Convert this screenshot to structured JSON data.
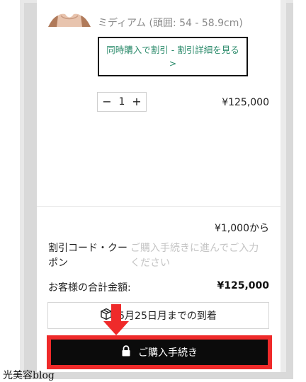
{
  "cart": {
    "item": {
      "variant": "ミディアム (頭囲: 54 - 58.9cm)",
      "promo_link": "同時購入で割引 - 割引詳細を見る >",
      "quantity": "1",
      "minus_label": "−",
      "plus_label": "+",
      "price": "¥125,000"
    },
    "summary": {
      "shipping": "¥1,000から",
      "discount_label": "割引コード・クーポン",
      "discount_placeholder": "ご購入手続きに進んでご入力ください",
      "total_label": "お客様の合計金額:",
      "total_value": "¥125,000",
      "delivery": "5月25日月までの到着",
      "checkout_label": "ご購入手続き"
    }
  },
  "annotation": {
    "highlight_color": "#ef2a2a"
  },
  "watermark": "光美容blog",
  "icons": [
    "product-thumbnail",
    "package-icon",
    "lock-icon",
    "down-arrow-icon"
  ]
}
